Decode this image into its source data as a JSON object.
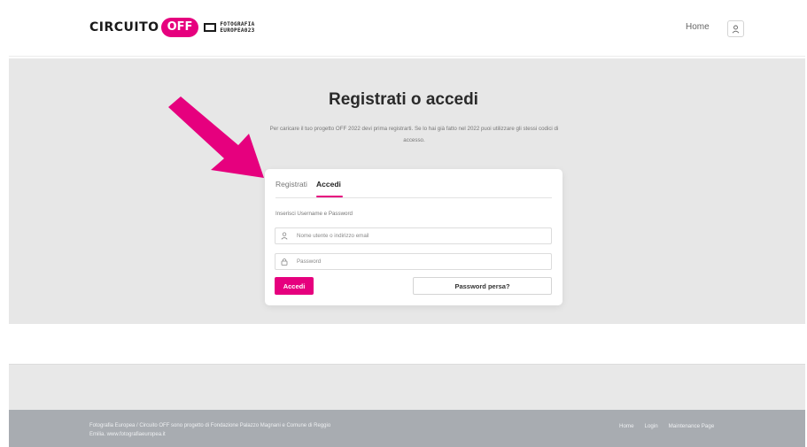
{
  "header": {
    "logo": {
      "word": "CIRCUITO",
      "badge": "OFF",
      "line1": "FOTOGRAFIA",
      "line2": "EUROPEA023"
    },
    "nav_home": "Home",
    "user_icon": "user-icon"
  },
  "hero": {
    "title": "Registrati o accedi",
    "subtitle": "Per caricare il tuo progetto OFF 2022 devi prima registrarti. Se lo hai già fatto nel 2022 puoi utilizzare gli stessi codici di accesso."
  },
  "colors": {
    "accent": "#e6007e",
    "hero_bg": "#e7e7e7",
    "footer_bg": "#a8acb1"
  },
  "login_card": {
    "tabs": [
      {
        "label": "Registrati",
        "active": false
      },
      {
        "label": "Accedi",
        "active": true
      }
    ],
    "instruction": "Inserisci Username e Password",
    "username": {
      "placeholder": "Nome utente o indirizzo email",
      "value": "",
      "icon": "user-icon"
    },
    "password": {
      "placeholder": "Password",
      "value": "",
      "icon": "lock-icon"
    },
    "submit_label": "Accedi",
    "lost_password_label": "Password persa?"
  },
  "footer": {
    "text_line1": "Fotografia Europea / Circuito OFF sono progetto di Fondazione Palazzo Magnani e Comune di Reggio",
    "text_line2": "Emilia. www.fotografiaeuropea.it",
    "links": [
      "Home",
      "Login",
      "Maintenance Page"
    ]
  }
}
